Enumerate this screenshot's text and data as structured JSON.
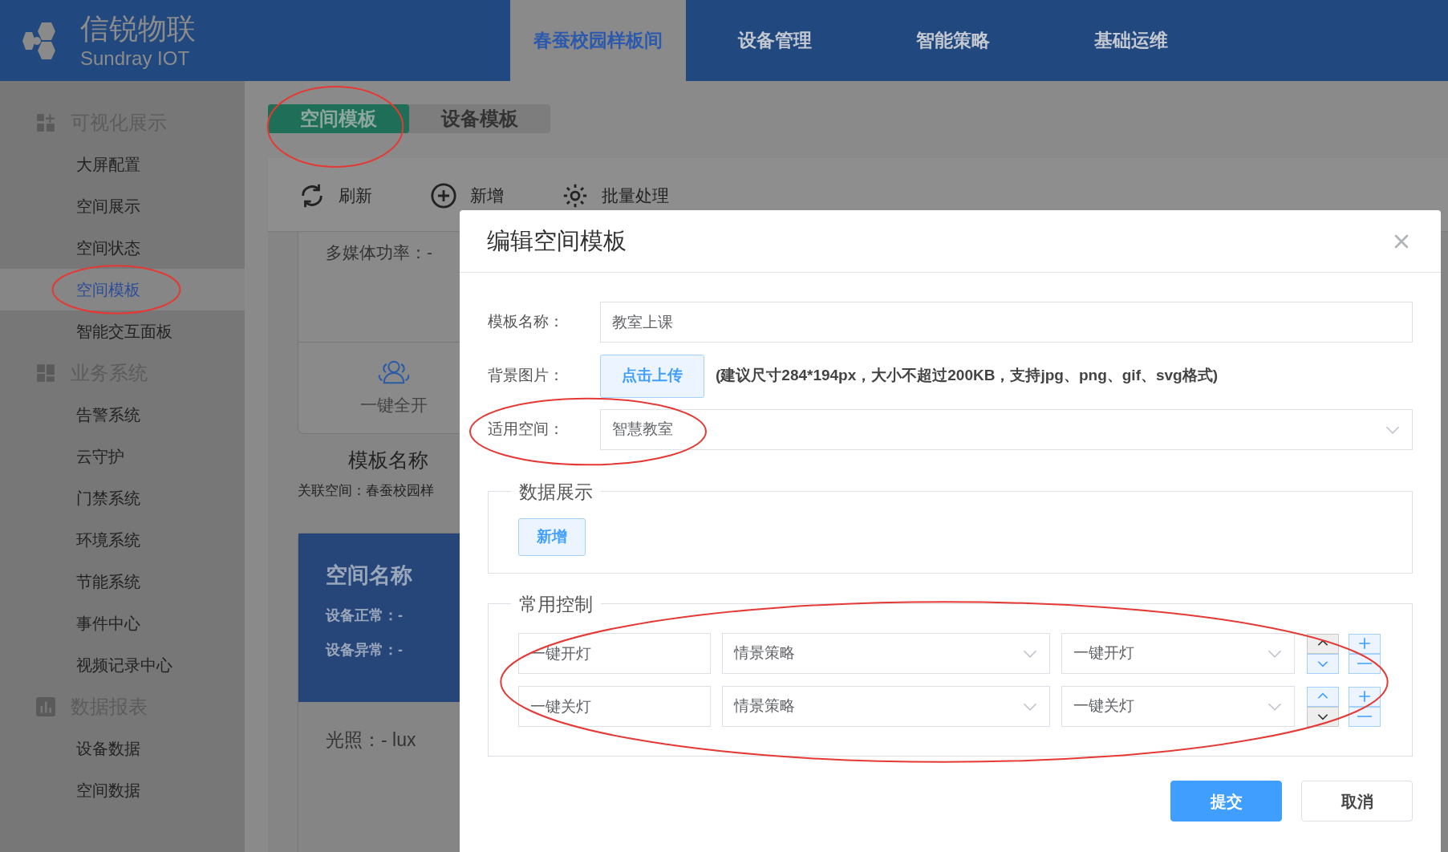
{
  "header": {
    "brand": "信锐物联",
    "brand_sub": "Sundray IOT",
    "nav": [
      {
        "label": "春蚕校园样板间",
        "selected": true
      },
      {
        "label": "设备管理",
        "selected": false
      },
      {
        "label": "智能策略",
        "selected": false
      },
      {
        "label": "基础运维",
        "selected": false
      }
    ]
  },
  "sidebar": {
    "groups": [
      {
        "title": "可视化展示",
        "items": [
          {
            "label": "大屏配置",
            "selected": false,
            "circled": false
          },
          {
            "label": "空间展示",
            "selected": false,
            "circled": false
          },
          {
            "label": "空间状态",
            "selected": false,
            "circled": false
          },
          {
            "label": "空间模板",
            "selected": true,
            "circled": true
          },
          {
            "label": "智能交互面板",
            "selected": false,
            "circled": false
          }
        ]
      },
      {
        "title": "业务系统",
        "items": [
          {
            "label": "告警系统",
            "selected": false,
            "circled": false
          },
          {
            "label": "云守护",
            "selected": false,
            "circled": false
          },
          {
            "label": "门禁系统",
            "selected": false,
            "circled": false
          },
          {
            "label": "环境系统",
            "selected": false,
            "circled": false
          },
          {
            "label": "节能系统",
            "selected": false,
            "circled": false
          },
          {
            "label": "事件中心",
            "selected": false,
            "circled": false
          },
          {
            "label": "视频记录中心",
            "selected": false,
            "circled": false
          }
        ]
      },
      {
        "title": "数据报表",
        "items": [
          {
            "label": "设备数据",
            "selected": false,
            "circled": false
          },
          {
            "label": "空间数据",
            "selected": false,
            "circled": false
          }
        ]
      }
    ]
  },
  "tabs": [
    {
      "label": "空间模板",
      "selected": true,
      "circled": true
    },
    {
      "label": "设备模板",
      "selected": false,
      "circled": false
    }
  ],
  "toolbar": [
    {
      "label": "刷新"
    },
    {
      "label": "新增"
    },
    {
      "label": "批量处理"
    }
  ],
  "template_card": {
    "metrics": [
      "多媒体功率：-"
    ],
    "action": "一键全开",
    "name": "模板名称",
    "space": "关联空间：春蚕校园样"
  },
  "space_card": {
    "title": "空间名称",
    "stats": [
      "设备正常：-",
      "设备异常：-"
    ],
    "reading": "光照：- lux"
  },
  "dialog": {
    "title": "编辑空间模板",
    "fields": [
      {
        "kind": "input",
        "label": "模板名称：",
        "value": "教室上课",
        "circled": false
      },
      {
        "kind": "upload",
        "label": "背景图片：",
        "button": "点击上传",
        "hint": "(建议尺寸284*194px，大小不超过200KB，支持jpg、png、gif、svg格式)",
        "circled": false
      },
      {
        "kind": "select",
        "label": "适用空间：",
        "value": "智慧教室",
        "circled": true
      }
    ],
    "data_display": {
      "legend": "数据展示",
      "button": "新增"
    },
    "common_controls": {
      "legend": "常用控制",
      "circled": true,
      "rows": [
        {
          "name": "一键开灯",
          "type": "情景策略",
          "action": "一键开灯",
          "up_disabled": true,
          "down_disabled": false
        },
        {
          "name": "一键关灯",
          "type": "情景策略",
          "action": "一键关灯",
          "up_disabled": false,
          "down_disabled": true
        }
      ]
    },
    "buttons": [
      {
        "label": "提交",
        "kind": "primary"
      },
      {
        "label": "取消",
        "kind": "default"
      }
    ]
  }
}
